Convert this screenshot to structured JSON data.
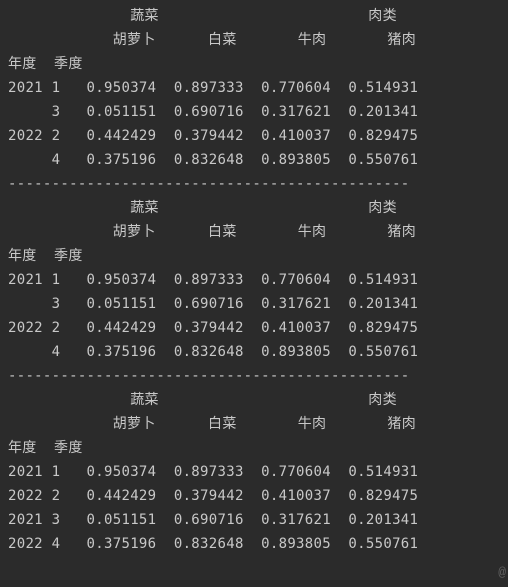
{
  "headers": {
    "group1": "蔬菜",
    "group2": "肉类",
    "col1": "胡萝卜",
    "col2": "白菜",
    "col3": "牛肉",
    "col4": "猪肉",
    "idx1": "年度",
    "idx2": "季度"
  },
  "separator": "----------------------------------------------",
  "watermark": "@",
  "blocks": [
    {
      "rows": [
        {
          "y": "2021",
          "q": "1",
          "v": [
            "0.950374",
            "0.897333",
            "0.770604",
            "0.514931"
          ]
        },
        {
          "y": "",
          "q": "3",
          "v": [
            "0.051151",
            "0.690716",
            "0.317621",
            "0.201341"
          ]
        },
        {
          "y": "2022",
          "q": "2",
          "v": [
            "0.442429",
            "0.379442",
            "0.410037",
            "0.829475"
          ]
        },
        {
          "y": "",
          "q": "4",
          "v": [
            "0.375196",
            "0.832648",
            "0.893805",
            "0.550761"
          ]
        }
      ]
    },
    {
      "rows": [
        {
          "y": "2021",
          "q": "1",
          "v": [
            "0.950374",
            "0.897333",
            "0.770604",
            "0.514931"
          ]
        },
        {
          "y": "",
          "q": "3",
          "v": [
            "0.051151",
            "0.690716",
            "0.317621",
            "0.201341"
          ]
        },
        {
          "y": "2022",
          "q": "2",
          "v": [
            "0.442429",
            "0.379442",
            "0.410037",
            "0.829475"
          ]
        },
        {
          "y": "",
          "q": "4",
          "v": [
            "0.375196",
            "0.832648",
            "0.893805",
            "0.550761"
          ]
        }
      ]
    },
    {
      "rows": [
        {
          "y": "2021",
          "q": "1",
          "v": [
            "0.950374",
            "0.897333",
            "0.770604",
            "0.514931"
          ]
        },
        {
          "y": "2022",
          "q": "2",
          "v": [
            "0.442429",
            "0.379442",
            "0.410037",
            "0.829475"
          ]
        },
        {
          "y": "2021",
          "q": "3",
          "v": [
            "0.051151",
            "0.690716",
            "0.317621",
            "0.201341"
          ]
        },
        {
          "y": "2022",
          "q": "4",
          "v": [
            "0.375196",
            "0.832648",
            "0.893805",
            "0.550761"
          ]
        }
      ]
    }
  ]
}
